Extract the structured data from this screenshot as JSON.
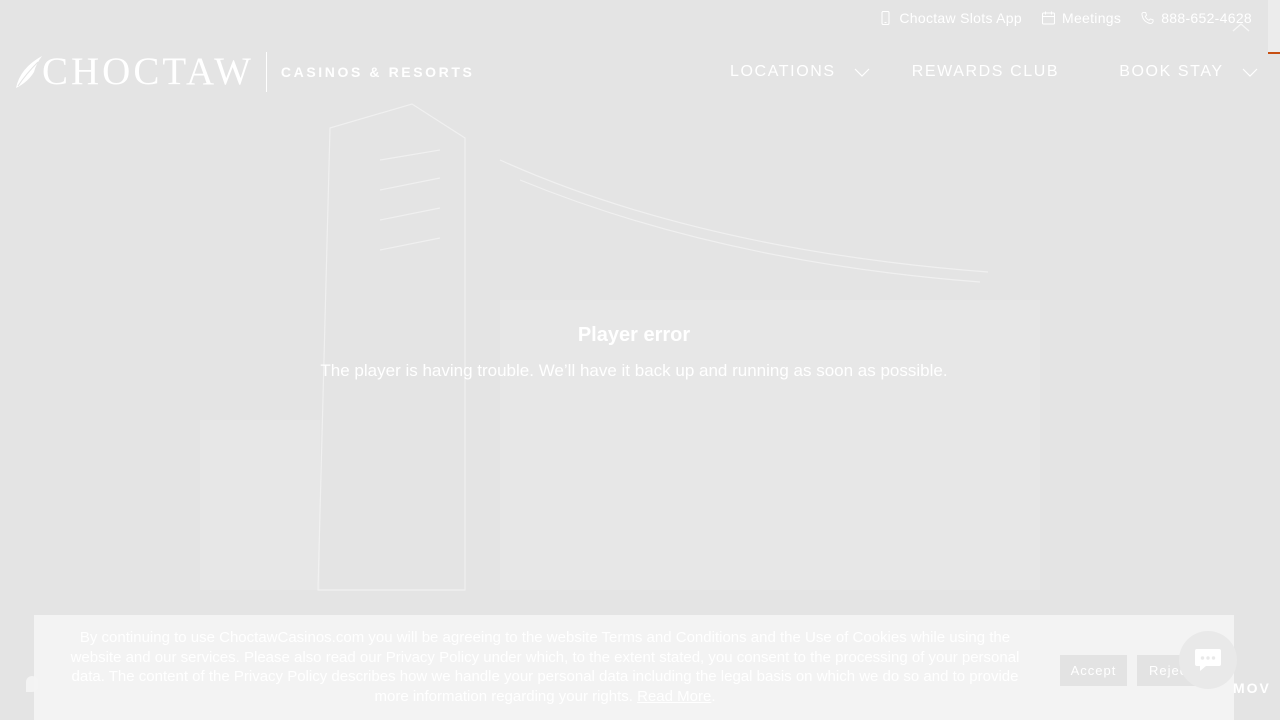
{
  "utility": {
    "slots_app": "Choctaw Slots App",
    "meetings": "Meetings",
    "phone": "888-652-4628"
  },
  "logo": {
    "word": "CHOCTAW",
    "sub": "CASINOS & RESORTS"
  },
  "nav": {
    "locations": "LOCATIONS",
    "rewards": "REWARDS CLUB",
    "book": "BOOK STAY"
  },
  "player_error": {
    "title": "Player error",
    "message": "The player is having trouble. We’ll have it back up and running as soon as possible."
  },
  "cookie": {
    "text": "By continuing to use ChoctawCasinos.com you will be agreeing to the website Terms and Conditions and the Use of Cookies while using the website and our services. Please also read our Privacy Policy under which, to the extent stated, you consent to the processing of your personal data. The content of the Privacy Policy describes how we handle your personal data including the legal basis on which we do so and to provide more information regarding your rights.",
    "read_more": "Read More",
    "accept": "Accept",
    "reject": "Reject"
  },
  "partial_text": "MOV",
  "colors": {
    "accent": "#c74f12",
    "background": "#e4e4e4",
    "foreground": "#ffffff"
  },
  "icons": [
    "phone-device-icon",
    "calendar-icon",
    "telephone-icon",
    "chevron-down-icon",
    "collapse-icon",
    "chat-icon",
    "feather-logo-icon"
  ]
}
